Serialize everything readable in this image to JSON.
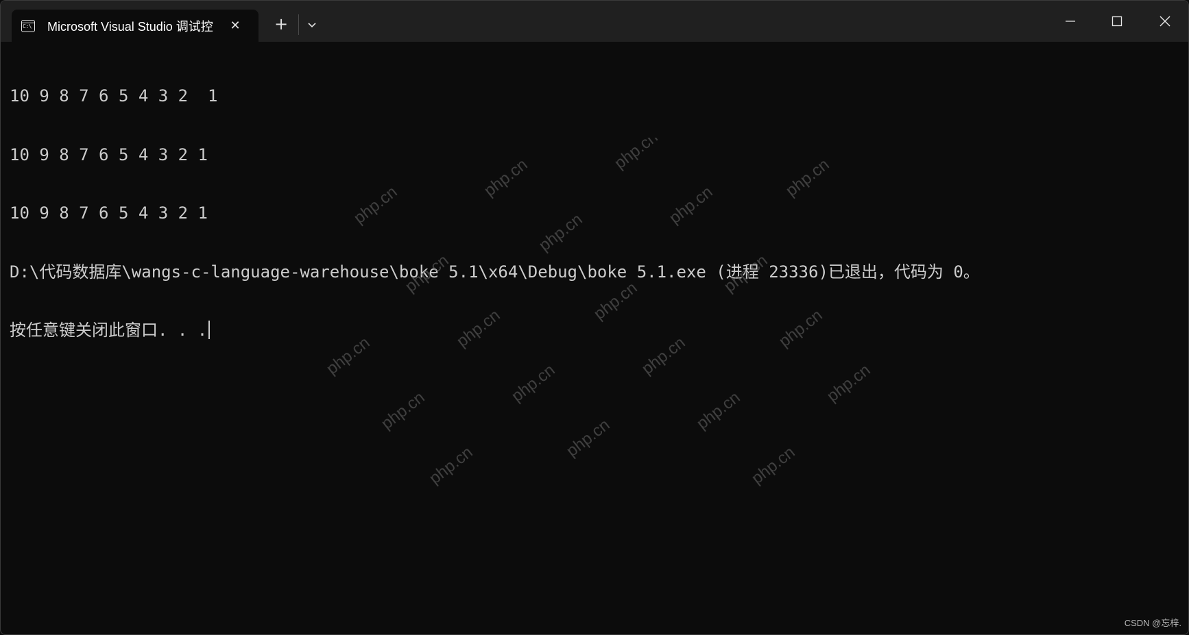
{
  "window": {
    "tab": {
      "icon": "console-icon",
      "icon_glyph": "C:\\",
      "title": "Microsoft Visual Studio 调试控",
      "close_glyph": "✕"
    },
    "new_tab_glyph": "+",
    "controls": {
      "minimize_icon": "minimize-icon",
      "maximize_icon": "maximize-icon",
      "close_icon": "close-icon"
    }
  },
  "console": {
    "lines": [
      "10 9 8 7 6 5 4 3 2  1",
      "10 9 8 7 6 5 4 3 2 1",
      "10 9 8 7 6 5 4 3 2 1",
      "D:\\代码数据库\\wangs-c-language-warehouse\\boke 5.1\\x64\\Debug\\boke 5.1.exe (进程 23336)已退出，代码为 0。",
      "按任意键关闭此窗口. . ."
    ],
    "text_color": "#cccccc",
    "background": "#0c0c0c"
  },
  "watermark": {
    "text": "php.cn"
  },
  "credit": "CSDN @忘梓."
}
